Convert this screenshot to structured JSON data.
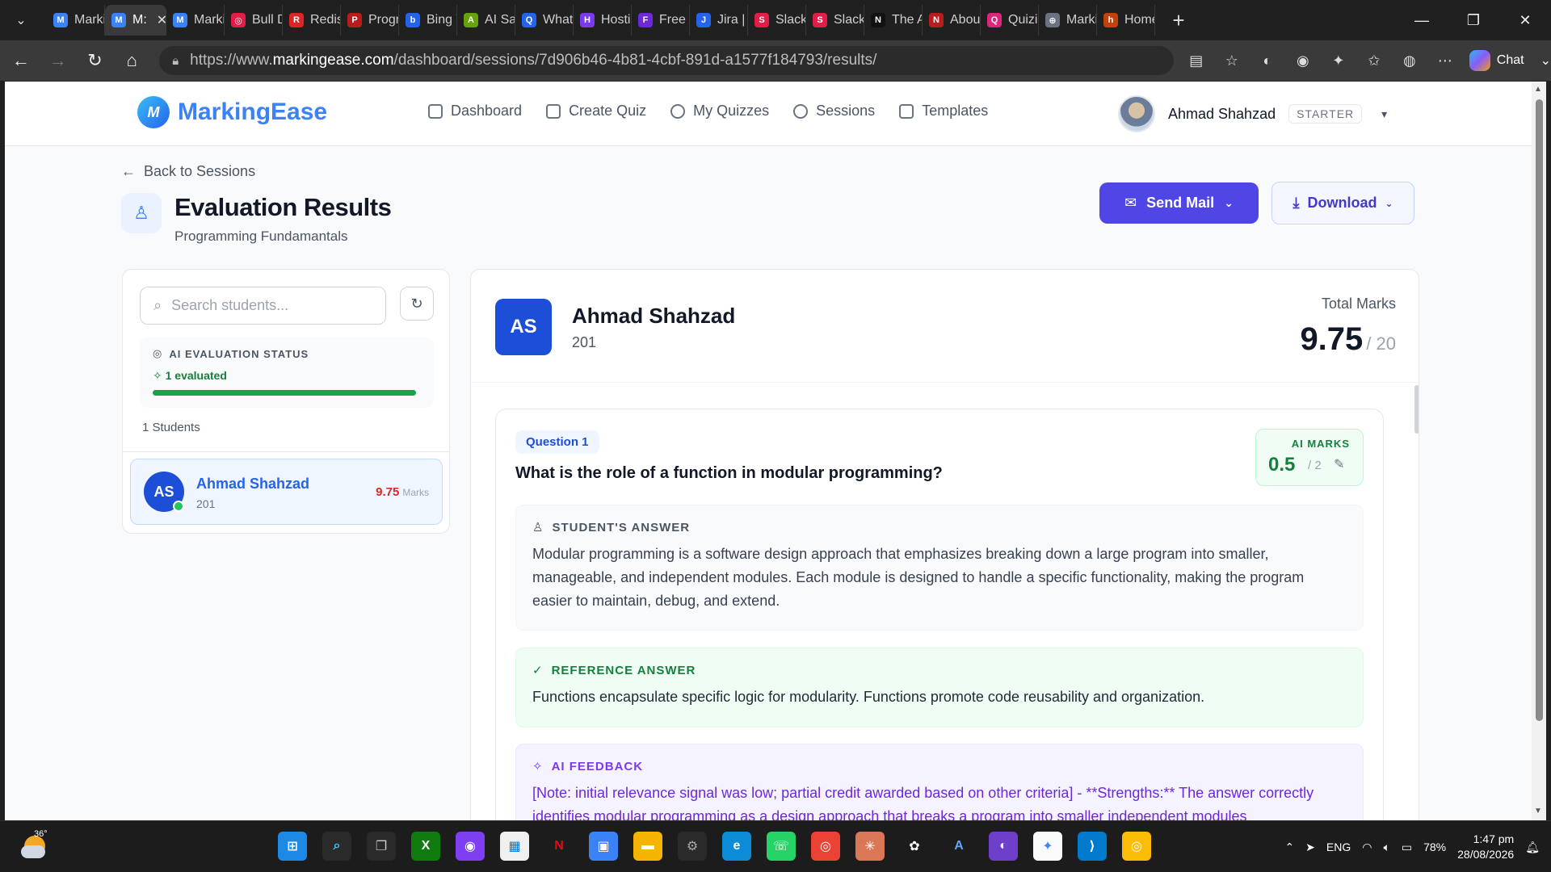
{
  "browser": {
    "tabs": [
      {
        "label": "Markir",
        "color": "#3b82f6",
        "glyph": "M"
      },
      {
        "label": "M:",
        "color": "#3b82f6",
        "glyph": "M",
        "active": true
      },
      {
        "label": "Markir",
        "color": "#3b82f6",
        "glyph": "M"
      },
      {
        "label": "Bull D",
        "color": "#e11d48",
        "glyph": "◎"
      },
      {
        "label": "Redis",
        "color": "#dc2626",
        "glyph": "R"
      },
      {
        "label": "Progra",
        "color": "#b91c1c",
        "glyph": "P"
      },
      {
        "label": "Bing V",
        "color": "#2563eb",
        "glyph": "b"
      },
      {
        "label": "AI Sal",
        "color": "#65a30d",
        "glyph": "A"
      },
      {
        "label": "What",
        "color": "#2563eb",
        "glyph": "Q"
      },
      {
        "label": "Hostin",
        "color": "#7c3aed",
        "glyph": "H"
      },
      {
        "label": "Free C",
        "color": "#6d28d9",
        "glyph": "F"
      },
      {
        "label": "Jira | I",
        "color": "#2563eb",
        "glyph": "J"
      },
      {
        "label": "Slack",
        "color": "#e11d48",
        "glyph": "S"
      },
      {
        "label": "Slack",
        "color": "#e11d48",
        "glyph": "S"
      },
      {
        "label": "The AI",
        "color": "#111111",
        "glyph": "N"
      },
      {
        "label": "About",
        "color": "#b91c1c",
        "glyph": "N"
      },
      {
        "label": "Quiziz",
        "color": "#db2777",
        "glyph": "Q"
      },
      {
        "label": "Markir",
        "color": "#6b7280",
        "glyph": "⊕"
      },
      {
        "label": "Home",
        "color": "#c2410c",
        "glyph": "h"
      }
    ],
    "url_prefix": "https://www.",
    "url_domain": "markingease.com",
    "url_path": "/dashboard/sessions/7d906b46-4b81-4cbf-891d-a1577f184793/results/",
    "chat_label": "Chat"
  },
  "app": {
    "brand": "MarkingEase",
    "nav": [
      "Dashboard",
      "Create Quiz",
      "My Quizzes",
      "Sessions",
      "Templates"
    ],
    "user_name": "Ahmad Shahzad",
    "plan": "STARTER"
  },
  "page": {
    "back_label": "Back to Sessions",
    "title": "Evaluation Results",
    "subtitle": "Programming Fundamantals",
    "send_mail": "Send Mail",
    "download": "Download"
  },
  "sidebar": {
    "search_placeholder": "Search students...",
    "ai_status_label": "AI EVALUATION STATUS",
    "evaluated_text": "1 evaluated",
    "progress": 1.0,
    "student_count": "1 Students",
    "students": [
      {
        "initials": "AS",
        "name": "Ahmad Shahzad",
        "id": "201",
        "marks": "9.75",
        "marks_label": "Marks"
      }
    ]
  },
  "result": {
    "initials": "AS",
    "name": "Ahmad Shahzad",
    "id": "201",
    "total_label": "Total Marks",
    "total": "9.75",
    "max": "/ 20",
    "question": {
      "tag": "Question 1",
      "text": "What is the role of a function in modular programming?",
      "ai_marks_label": "AI MARKS",
      "ai_marks": "0.5",
      "ai_max": "/ 2",
      "student_answer_label": "STUDENT'S ANSWER",
      "student_answer": "Modular programming is a software design approach that emphasizes breaking down a large program into smaller, manageable, and independent modules. Each module is designed to handle a specific functionality, making the program easier to maintain, debug, and extend.",
      "reference_label": "REFERENCE ANSWER",
      "reference": "Functions encapsulate specific logic for modularity. Functions promote code reusability and organization.",
      "feedback_label": "AI FEEDBACK",
      "feedback": "[Note: initial relevance signal was low; partial credit awarded based on other criteria] - **Strengths:** The answer correctly identifies modular programming as a design approach that breaks a program into smaller independent modules"
    }
  },
  "taskbar": {
    "temp": "36°",
    "lang": "ENG",
    "battery": "78%",
    "time": "1:47 pm",
    "date": "28/08/2026"
  }
}
